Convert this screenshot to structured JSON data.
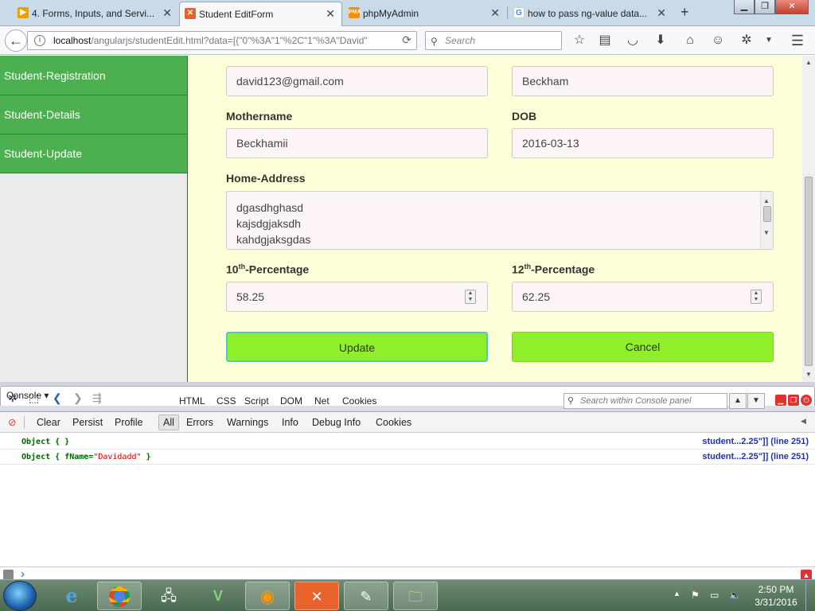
{
  "browser": {
    "tabs": [
      {
        "title": "4. Forms, Inputs, and Servi...",
        "active": false
      },
      {
        "title": "Student EditForm",
        "active": true
      },
      {
        "title": "phpMyAdmin",
        "active": false
      },
      {
        "title": "how to pass ng-value data...",
        "active": false
      }
    ],
    "url_host": "localhost",
    "url_path": "/angularjs/studentEdit.html?data=[{\"0\"%3A\"1\"%2C\"1\"%3A\"David\"",
    "search_placeholder": "Search"
  },
  "sidebar": {
    "items": [
      {
        "label": "Student-Registration"
      },
      {
        "label": "Student-Details"
      },
      {
        "label": "Student-Update"
      }
    ]
  },
  "form": {
    "email_value": "david123@gmail.com",
    "fathername_value": "Beckham",
    "mothername_label": "Mothername",
    "mothername_value": "Beckhamii",
    "dob_label": "DOB",
    "dob_value": "2016-03-13",
    "address_label": "Home-Address",
    "address_lines": [
      "dgasdhghasd",
      "kajsdgjaksdh",
      "kahdgjaksgdas"
    ],
    "tenth_label_pre": "10",
    "tenth_label_sup": "th",
    "tenth_label_post": "-Percentage",
    "tenth_value": "58.25",
    "twelfth_label_pre": "12",
    "twelfth_label_sup": "th",
    "twelfth_label_post": "-Percentage",
    "twelfth_value": "62.25",
    "update_label": "Update",
    "cancel_label": "Cancel"
  },
  "firebug": {
    "panels": [
      "Console",
      "HTML",
      "CSS",
      "Script",
      "DOM",
      "Net",
      "Cookies"
    ],
    "search_placeholder": "Search within Console panel",
    "subbar": [
      "Clear",
      "Persist",
      "Profile",
      "All",
      "Errors",
      "Warnings",
      "Info",
      "Debug Info",
      "Cookies"
    ],
    "logs": [
      {
        "prefix": "Object {  }",
        "key": "",
        "value": "",
        "suffix": "",
        "source": "student...2.25\"]] (line 251)"
      },
      {
        "prefix": "Object { ",
        "key": "fName=",
        "value": "\"Davidadd\"",
        "suffix": " }",
        "source": "student...2.25\"]] (line 251)"
      }
    ],
    "cmd_prompt": "›"
  },
  "taskbar": {
    "time": "2:50 PM",
    "date": "3/31/2016"
  },
  "colors": {
    "sidebar_green": "#4caf50",
    "button_lime": "#8fef2a",
    "page_background": "#fefed8"
  }
}
